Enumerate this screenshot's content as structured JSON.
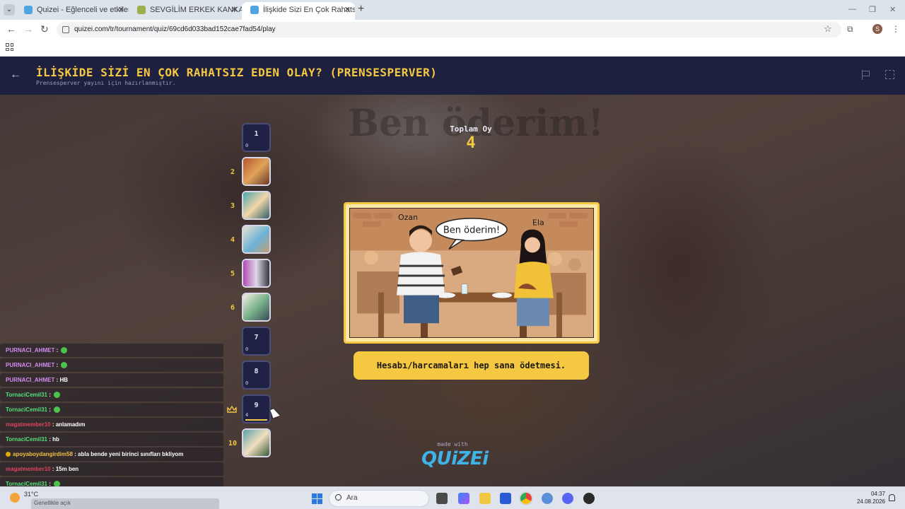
{
  "browser": {
    "tabs": [
      {
        "title": "Quizei - Eğlenceli ve etkileşimli",
        "active": false,
        "favicon_color": "#4fa3e0"
      },
      {
        "title": "SEVGİLİM ERKEK KANKASI İLE !",
        "active": false,
        "favicon_color": "#9bb04a"
      },
      {
        "title": "İlişkide Sizi En Çok Rahatsız Ede",
        "active": true,
        "favicon_color": "#4fa3e0"
      }
    ],
    "url": "quizei.com/tr/tournament/quiz/69cd6d033bad152cae7fad54/play",
    "profile_initial": "S"
  },
  "header": {
    "title": "İLİŞKİDE SİZİ EN ÇOK RAHATSIZ EDEN OLAY? (PRENSESPERVER)",
    "subtitle": "Prensesperver yayını için hazırlanmıştır."
  },
  "rounds": [
    {
      "num": "1",
      "votes": "0",
      "type": "text"
    },
    {
      "num": "2",
      "type": "image"
    },
    {
      "num": "3",
      "type": "image"
    },
    {
      "num": "4",
      "type": "image"
    },
    {
      "num": "5",
      "type": "image"
    },
    {
      "num": "6",
      "type": "image"
    },
    {
      "num": "7",
      "votes": "0",
      "type": "text"
    },
    {
      "num": "8",
      "votes": "0",
      "type": "text"
    },
    {
      "num": "9",
      "votes": "4",
      "type": "text",
      "leader": true,
      "vote_fraction": 1.0
    },
    {
      "num": "10",
      "type": "image"
    }
  ],
  "vote_panel": {
    "label": "Toplam Oy",
    "total": "4"
  },
  "scene": {
    "speech": "Ben öderim!",
    "name_left": "Ozan",
    "name_right": "Ela"
  },
  "answer": "Hesabı/harcamaları hep sana ödetmesi.",
  "branding": {
    "made_with": "made with",
    "logo": "QUiZEi"
  },
  "chat": [
    {
      "user": "PURNACI_AHMET",
      "user_color": "#d38bf0",
      "sep": " : ",
      "msg": "",
      "emote": true
    },
    {
      "user": "PURNACI_AHMET",
      "user_color": "#d38bf0",
      "sep": " : ",
      "msg": "",
      "emote": true
    },
    {
      "user": "PURNACI_AHMET",
      "user_color": "#d38bf0",
      "sep": " : ",
      "msg": "HB",
      "emote": false
    },
    {
      "user": "TornaciCemil31",
      "user_color": "#56e07a",
      "sep": " : ",
      "msg": "",
      "emote": true
    },
    {
      "user": "TornaciCemil31",
      "user_color": "#56e07a",
      "sep": " : ",
      "msg": "",
      "emote": true
    },
    {
      "user": "magatmember10",
      "user_color": "#e0455e",
      "sep": " : ",
      "msg": "anlamadım",
      "emote": false
    },
    {
      "user": "TornaciCemil31",
      "user_color": "#56e07a",
      "sep": " : ",
      "msg": "hb",
      "emote": false
    },
    {
      "user": "apoyaboydangirdim58",
      "user_color": "#f0c040",
      "sep": " : ",
      "msg": "abla bende yeni birinci sınıfları bkliyom",
      "emote": false,
      "badge": true
    },
    {
      "user": "magatmember10",
      "user_color": "#e0455e",
      "sep": " : ",
      "msg": "15m ben",
      "emote": false
    },
    {
      "user": "TornaciCemil31",
      "user_color": "#56e07a",
      "sep": " : ",
      "msg": "",
      "emote": true
    }
  ],
  "taskbar": {
    "weather_temp": "31°C",
    "weather_desc": "Genellikle açık",
    "search_placeholder": "Ara",
    "time": "04:37",
    "date": "24.08.2026"
  }
}
